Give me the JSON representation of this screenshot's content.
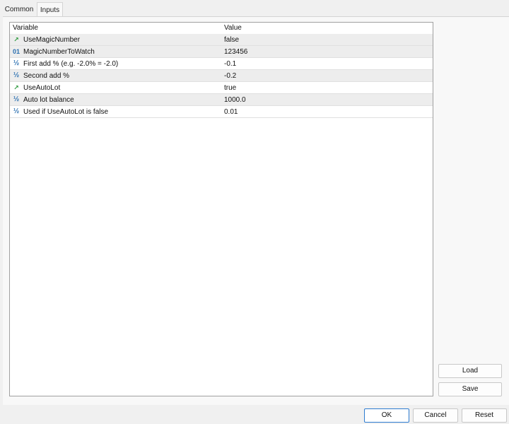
{
  "tabs": [
    {
      "label": "Common"
    },
    {
      "label": "Inputs"
    }
  ],
  "grid": {
    "headers": {
      "variable": "Variable",
      "value": "Value"
    },
    "rows": [
      {
        "icon": "boolean-icon",
        "name": "UseMagicNumber",
        "value": "false"
      },
      {
        "icon": "integer-icon",
        "name": "MagicNumberToWatch",
        "value": "123456"
      },
      {
        "icon": "double-icon",
        "name": "First add % (e.g. -2.0% = -2.0)",
        "value": "-0.1"
      },
      {
        "icon": "double-icon",
        "name": "Second add %",
        "value": "-0.2"
      },
      {
        "icon": "boolean-icon",
        "name": "UseAutoLot",
        "value": "true"
      },
      {
        "icon": "double-icon",
        "name": "Auto lot balance",
        "value": "1000.0"
      },
      {
        "icon": "double-icon",
        "name": "Used if UseAutoLot is false",
        "value": "0.01"
      }
    ]
  },
  "buttons": {
    "load": "Load",
    "save": "Save",
    "ok": "OK",
    "cancel": "Cancel",
    "reset": "Reset"
  },
  "colors": {
    "ok_border": "#2d7bd0",
    "bool_icon": "#2e9a3e",
    "numeric_icon": "#2a6fb0"
  }
}
